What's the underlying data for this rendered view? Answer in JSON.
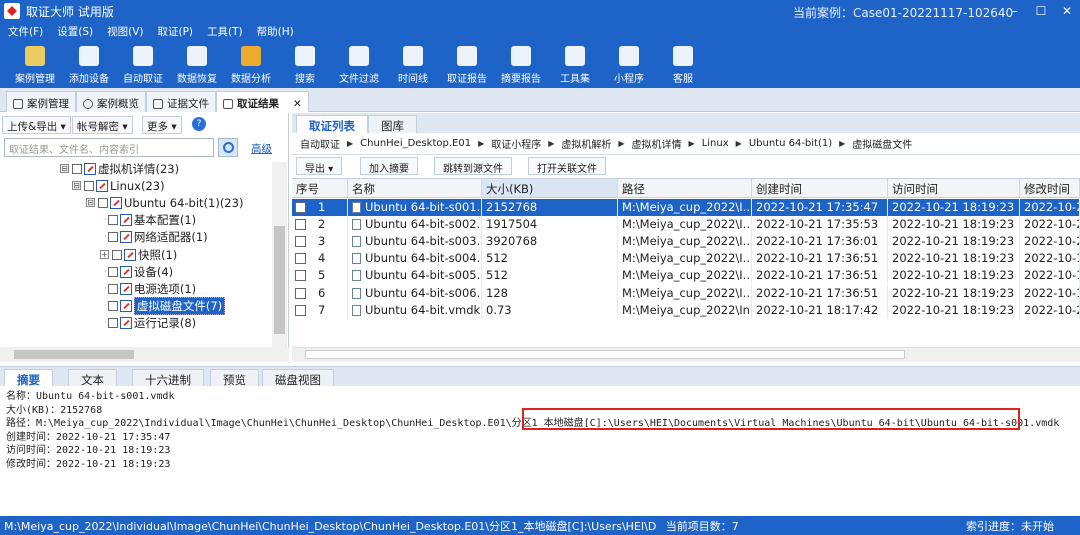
{
  "window": {
    "app_title": "取证大师 试用版",
    "current_case": "当前案例：Case01-20221117-102640",
    "min": "–",
    "max": "☐",
    "close": "✕"
  },
  "menu": [
    "文件(F)",
    "设置(S)",
    "视图(V)",
    "取证(P)",
    "工具(T)",
    "帮助(H)"
  ],
  "toolbar": [
    {
      "label": "案例管理",
      "color": "#ffd45a"
    },
    {
      "label": "添加设备",
      "color": "#ffffff"
    },
    {
      "label": "自动取证",
      "color": "#ffffff"
    },
    {
      "label": "数据恢复",
      "color": "#ffffff"
    },
    {
      "label": "数据分析",
      "color": "#ffb020"
    },
    {
      "label": "搜索",
      "color": "#ffffff"
    },
    {
      "label": "文件过滤",
      "color": "#ffffff"
    },
    {
      "label": "时间线",
      "color": "#ffffff"
    },
    {
      "label": "取证报告",
      "color": "#ffffff"
    },
    {
      "label": "摘要报告",
      "color": "#ffffff"
    },
    {
      "label": "工具集",
      "color": "#ffffff"
    },
    {
      "label": "小程序",
      "color": "#ffffff"
    },
    {
      "label": "客服",
      "color": "#ffffff"
    }
  ],
  "main_tabs": [
    "案例管理",
    "案例概览",
    "证据文件",
    "取证结果"
  ],
  "active_main_tab": "取证结果",
  "left": {
    "btn_upload": "上传&导出 ▾",
    "btn_decrypt": "帐号解密 ▾",
    "btn_more": "更多 ▾",
    "help": "?",
    "search_placeholder": "取证结果、文件名、内容索引",
    "advanced": "高级",
    "tree": [
      {
        "label": "虚拟机详情(23)",
        "exp": "⊟"
      },
      {
        "label": "Linux(23)",
        "exp": "⊟"
      },
      {
        "label": "Ubuntu 64-bit(1)(23)",
        "exp": "⊟"
      },
      {
        "label": "基本配置(1)",
        "exp": ""
      },
      {
        "label": "网络适配器(1)",
        "exp": ""
      },
      {
        "label": "快照(1)",
        "exp": "+"
      },
      {
        "label": "设备(4)",
        "exp": ""
      },
      {
        "label": "电源选项(1)",
        "exp": ""
      },
      {
        "label": "虚拟磁盘文件(7)",
        "exp": ""
      },
      {
        "label": "运行记录(8)",
        "exp": ""
      }
    ]
  },
  "right": {
    "tabs": [
      "取证列表",
      "图库"
    ],
    "breadcrumb": [
      "自动取证",
      "ChunHei_Desktop.E01",
      "取证小程序",
      "虚拟机解析",
      "虚拟机详情",
      "Linux",
      "Ubuntu 64-bit(1)",
      "虚拟磁盘文件"
    ],
    "actions": [
      "导出 ▾",
      "加入摘要",
      "跳转到源文件",
      "打开关联文件"
    ],
    "columns": [
      "序号",
      "名称",
      "大小(KB)",
      "路径",
      "创建时间",
      "访问时间",
      "修改时间"
    ],
    "rows": [
      {
        "no": "1",
        "name": "Ubuntu 64-bit-s001....",
        "size": "2152768",
        "path": "M:\\Meiya_cup_2022\\I...",
        "created": "2022-10-21 17:35:47",
        "accessed": "2022-10-21 18:19:23",
        "modified": "2022-10-2"
      },
      {
        "no": "2",
        "name": "Ubuntu 64-bit-s002....",
        "size": "1917504",
        "path": "M:\\Meiya_cup_2022\\I...",
        "created": "2022-10-21 17:35:53",
        "accessed": "2022-10-21 18:19:23",
        "modified": "2022-10-2"
      },
      {
        "no": "3",
        "name": "Ubuntu 64-bit-s003....",
        "size": "3920768",
        "path": "M:\\Meiya_cup_2022\\I...",
        "created": "2022-10-21 17:36:01",
        "accessed": "2022-10-21 18:19:23",
        "modified": "2022-10-2"
      },
      {
        "no": "4",
        "name": "Ubuntu 64-bit-s004....",
        "size": "512",
        "path": "M:\\Meiya_cup_2022\\I...",
        "created": "2022-10-21 17:36:51",
        "accessed": "2022-10-21 18:19:23",
        "modified": "2022-10-1"
      },
      {
        "no": "5",
        "name": "Ubuntu 64-bit-s005....",
        "size": "512",
        "path": "M:\\Meiya_cup_2022\\I...",
        "created": "2022-10-21 17:36:51",
        "accessed": "2022-10-21 18:19:23",
        "modified": "2022-10-1"
      },
      {
        "no": "6",
        "name": "Ubuntu 64-bit-s006....",
        "size": "128",
        "path": "M:\\Meiya_cup_2022\\I...",
        "created": "2022-10-21 17:36:51",
        "accessed": "2022-10-21 18:19:23",
        "modified": "2022-10-1"
      },
      {
        "no": "7",
        "name": "Ubuntu 64-bit.vmdk",
        "size": "0.73",
        "path": "M:\\Meiya_cup_2022\\In...",
        "created": "2022-10-21 18:17:42",
        "accessed": "2022-10-21 18:19:23",
        "modified": "2022-10-2"
      }
    ],
    "selected_row": 0
  },
  "bottom": {
    "tabs": [
      "摘要",
      "文本",
      "十六进制",
      "预览",
      "磁盘视图"
    ],
    "lines": [
      "名称：Ubuntu 64-bit-s001.vmdk",
      "大小(KB)：2152768",
      "路径：M:\\Meiya_cup_2022\\Individual\\Image\\ChunHei\\ChunHei_Desktop\\ChunHei_Desktop.E01\\分区1_本地磁盘[C]:\\Users\\HEI\\Documents\\Virtual Machines\\Ubuntu 64-bit\\Ubuntu 64-bit-s001.vmdk",
      "创建时间：2022-10-21 17:35:47",
      "访问时间：2022-10-21 18:19:23",
      "修改时间：2022-10-21 18:19:23"
    ]
  },
  "status": {
    "path": "M:\\Meiya_cup_2022\\Individual\\Image\\ChunHei\\ChunHei_Desktop\\ChunHei_Desktop.E01\\分区1_本地磁盘[C]:\\Users\\HEI\\D",
    "count": "当前项目数：7",
    "index": "索引进度：未开始"
  },
  "colors": {
    "brand": "#1e63c7",
    "selection": "#1e63c7",
    "highlight_box": "#e0221c"
  }
}
